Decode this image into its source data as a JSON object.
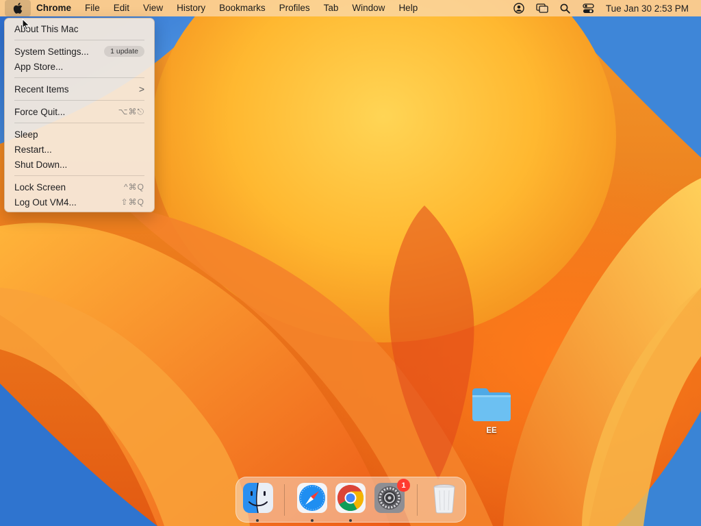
{
  "menubar": {
    "apple_icon": "apple-logo-icon",
    "app_name": "Chrome",
    "menus": [
      "File",
      "Edit",
      "View",
      "History",
      "Bookmarks",
      "Profiles",
      "Tab",
      "Window",
      "Help"
    ],
    "status_icons": [
      "user-account-icon",
      "screen-mirroring-icon",
      "search-icon",
      "control-center-icon"
    ],
    "clock": "Tue Jan 30  2:53 PM"
  },
  "apple_menu": {
    "about": "About This Mac",
    "system_settings": "System Settings...",
    "system_settings_badge": "1 update",
    "app_store": "App Store...",
    "recent_items": "Recent Items",
    "recent_items_chevron": ">",
    "force_quit": "Force Quit...",
    "force_quit_shortcut": "⌥⌘⎋",
    "sleep": "Sleep",
    "restart": "Restart...",
    "shut_down": "Shut Down...",
    "lock_screen": "Lock Screen",
    "lock_screen_shortcut": "^⌘Q",
    "log_out": "Log Out VM4...",
    "log_out_shortcut": "⇧⌘Q"
  },
  "desktop": {
    "folder_label": "EE"
  },
  "dock": {
    "apps": [
      {
        "icon": "finder-icon",
        "running": true
      },
      {
        "icon": "safari-icon",
        "running": true
      },
      {
        "icon": "chrome-icon",
        "running": true
      },
      {
        "icon": "system-settings-icon",
        "running": false,
        "badge": "1"
      },
      {
        "icon": "trash-icon",
        "running": false
      }
    ]
  },
  "colors": {
    "accent_red": "#ff3b30",
    "wallpaper_orange": "#f29a2a",
    "wallpaper_blue": "#3f86d6"
  }
}
